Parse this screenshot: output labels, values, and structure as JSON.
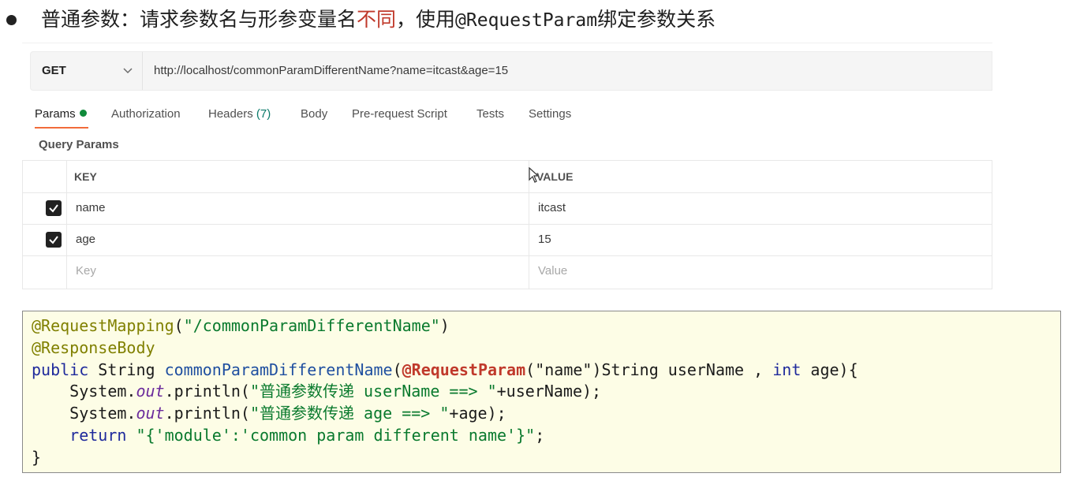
{
  "heading": {
    "prefix": "普通参数：请求参数名与形参变量名",
    "highlight": "不同",
    "sep": "，使用",
    "annotation": "@RequestParam",
    "suffix": "绑定参数关系"
  },
  "request": {
    "method": "GET",
    "url": "http://localhost/commonParamDifferentName?name=itcast&age=15"
  },
  "tabs": {
    "params": "Params",
    "authorization": "Authorization",
    "headers": "Headers",
    "headers_count": "(7)",
    "body": "Body",
    "prerequest": "Pre-request Script",
    "tests": "Tests",
    "settings": "Settings"
  },
  "query_params": {
    "title": "Query Params",
    "key_header": "KEY",
    "value_header": "VALUE",
    "rows": [
      {
        "key": "name",
        "value": "itcast",
        "checked": true
      },
      {
        "key": "age",
        "value": "15",
        "checked": true
      }
    ],
    "key_placeholder": "Key",
    "value_placeholder": "Value"
  },
  "code": {
    "l1_ann": "@RequestMapping",
    "l1_rest1": "(",
    "l1_str": "\"/commonParamDifferentName\"",
    "l1_rest2": ")",
    "l2_ann": "@ResponseBody",
    "l3_public": "public",
    "l3_string": " String ",
    "l3_fn": "commonParamDifferentName",
    "l3_open": "(",
    "l3_ann": "@RequestParam",
    "l3_arg": "(\"name\")",
    "l3_rest": "String userName , ",
    "l3_int": "int",
    "l3_end": " age){",
    "l4_a": "    System.",
    "l4_out": "out",
    "l4_b": ".println(",
    "l4_q1": "\"",
    "l4_cn": "普通参数传递",
    "l4_str": " userName ==> \"",
    "l4_c": "+userName);",
    "l5_a": "    System.",
    "l5_out": "out",
    "l5_b": ".println(",
    "l5_q1": "\"",
    "l5_cn": "普通参数传递",
    "l5_str": " age ==> \"",
    "l5_c": "+age);",
    "l6_ret": "    return ",
    "l6_str": "\"{'module':'common param different name'}\"",
    "l6_end": ";",
    "l7": "}"
  },
  "colors": {
    "accent": "#f26b3a",
    "dot": "#0f8a3a",
    "highlight": "#c0392b",
    "code_bg": "#fdfde6"
  }
}
